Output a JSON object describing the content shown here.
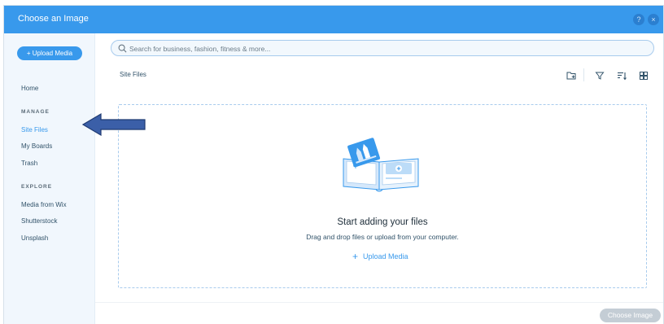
{
  "header": {
    "title": "Choose an Image",
    "help_glyph": "?",
    "close_glyph": "×"
  },
  "sidebar": {
    "upload_label": "+ Upload Media",
    "home": "Home",
    "manage_heading": "MANAGE",
    "manage_items": [
      "Site Files",
      "My Boards",
      "Trash"
    ],
    "explore_heading": "EXPLORE",
    "explore_items": [
      "Media from Wix",
      "Shutterstock",
      "Unsplash"
    ],
    "active_item": "Site Files"
  },
  "search": {
    "placeholder": "Search for business, fashion, fitness & more..."
  },
  "breadcrumb": "Site Files",
  "toolbar_icons": [
    "add-folder-icon",
    "filter-icon",
    "sort-icon",
    "grid-view-icon"
  ],
  "dropzone": {
    "title": "Start adding your files",
    "subtitle": "Drag and drop files or upload from your computer.",
    "upload_link": "Upload Media",
    "plus_glyph": "+"
  },
  "footer": {
    "choose_label": "Choose Image"
  },
  "colors": {
    "accent": "#3899ec",
    "sidebar_bg": "#f1f7fd",
    "disabled_button": "#c4cdd5",
    "annotation_arrow": "#3b5fa8"
  }
}
